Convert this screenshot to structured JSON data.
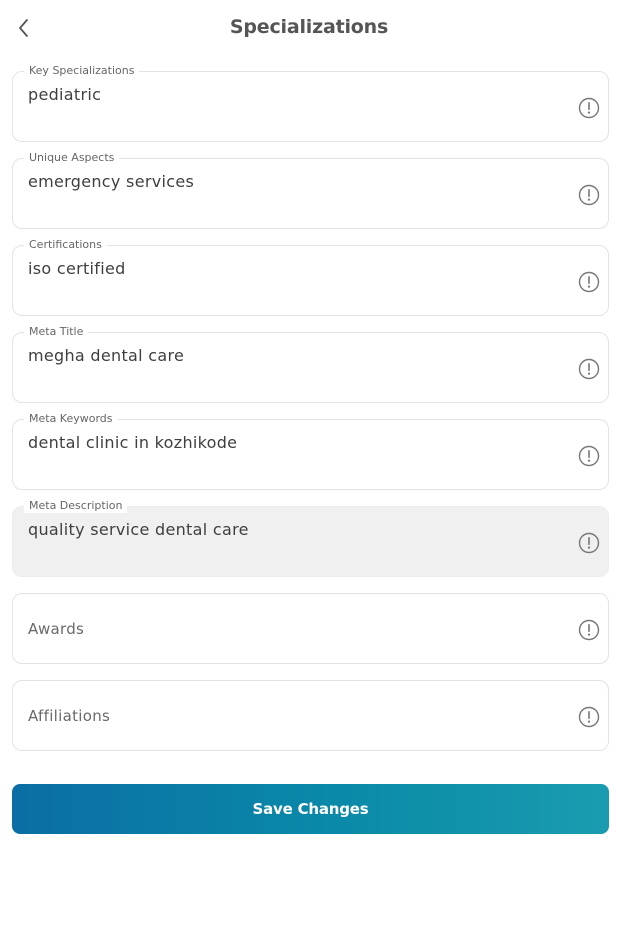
{
  "header": {
    "title": "Specializations",
    "back_icon": "chevron-left-icon"
  },
  "fields": [
    {
      "label": "Key Specializations",
      "value": "pediatric"
    },
    {
      "label": "Unique Aspects",
      "value": "emergency services"
    },
    {
      "label": "Certifications",
      "value": "iso certified"
    },
    {
      "label": "Meta Title",
      "value": "megha dental care"
    },
    {
      "label": "Meta Keywords",
      "value": "dental clinic in kozhikode"
    },
    {
      "label": "Meta Description",
      "value": "quality service dental care"
    },
    {
      "placeholder": "Awards"
    },
    {
      "placeholder": "Affiliations"
    }
  ],
  "info_icon": "info-circle-icon",
  "save_button": {
    "label": "Save Changes",
    "color_start": "#0b6ea4",
    "color_end": "#1a9cb0"
  }
}
